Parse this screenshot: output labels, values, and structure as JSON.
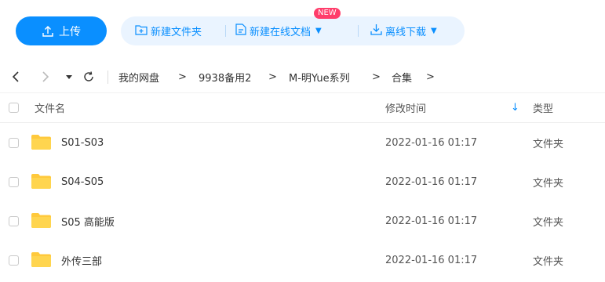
{
  "toolbar": {
    "upload_label": "上传",
    "new_folder_label": "新建文件夹",
    "new_online_doc_label": "新建在线文档",
    "new_badge": "NEW",
    "offline_download_label": "离线下载"
  },
  "breadcrumb": {
    "items": [
      "我的网盘",
      "9938备用2",
      "M-明Yue系列",
      "合集"
    ],
    "separator": ">"
  },
  "table": {
    "columns": {
      "name": "文件名",
      "modified": "修改时间",
      "type": "类型"
    },
    "sort_indicator": "↓",
    "rows": [
      {
        "name": "S01-S03",
        "modified": "2022-01-16 01:17",
        "type": "文件夹"
      },
      {
        "name": "S04-S05",
        "modified": "2022-01-16 01:17",
        "type": "文件夹"
      },
      {
        "name": "S05 高能版",
        "modified": "2022-01-16 01:17",
        "type": "文件夹"
      },
      {
        "name": "外传三部",
        "modified": "2022-01-16 01:17",
        "type": "文件夹"
      }
    ]
  },
  "colors": {
    "accent": "#0a8fff",
    "accent_light": "#eaf4ff",
    "badge": "#ff3d6b",
    "folder": "#ffc93c"
  },
  "icons": [
    "upload-icon",
    "new-folder-icon",
    "online-doc-icon",
    "download-icon",
    "back-icon",
    "forward-icon",
    "dropdown-icon",
    "refresh-icon",
    "sort-desc-icon",
    "folder-icon"
  ]
}
